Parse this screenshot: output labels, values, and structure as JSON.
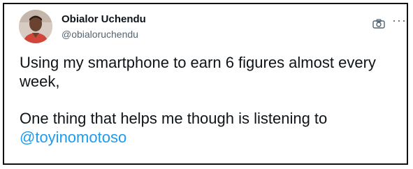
{
  "tweet": {
    "author_name": "Obialor Uchendu",
    "author_handle": "@obialoruchendu",
    "icons": {
      "media": "camera-icon",
      "menu": "more-options-icon"
    },
    "more_symbol": "···",
    "text_line1": "Using my smartphone to earn 6 figures almost every",
    "text_line2": "week,",
    "text_line3": "One thing that helps me though is listening to",
    "mention": "@toyinomotoso"
  },
  "colors": {
    "text": "#0f1419",
    "secondary": "#536471",
    "link": "#1d9bf0",
    "border": "#111111"
  }
}
